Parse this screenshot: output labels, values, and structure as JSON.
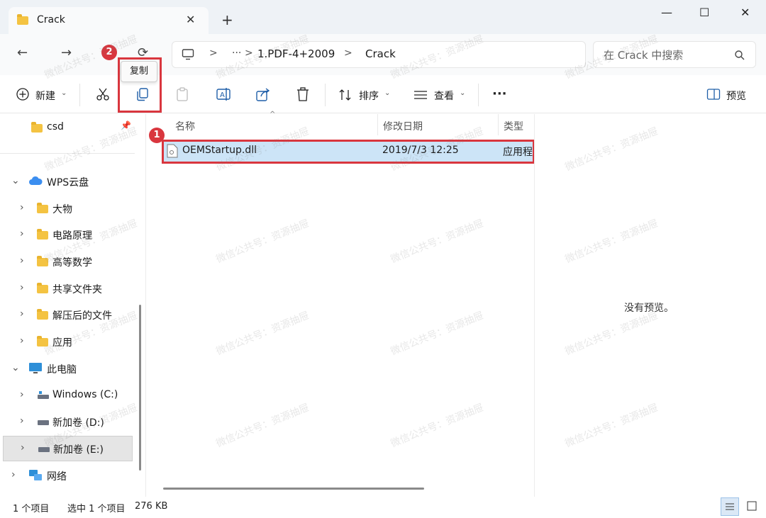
{
  "window": {
    "tab_title": "Crack",
    "tab_close": "✕",
    "new_tab": "+",
    "minimize": "—",
    "maximize": "☐",
    "close": "✕"
  },
  "nav": {
    "back": "←",
    "forward": "→",
    "refresh": "⟳",
    "breadcrumb": {
      "pc_icon": "monitor-icon",
      "more": "···",
      "sep": ">",
      "items": [
        "1.PDF-4+2009",
        "Crack"
      ]
    },
    "search_placeholder": "在 Crack 中搜索"
  },
  "toolbar": {
    "new_label": "新建",
    "sort_label": "排序",
    "view_label": "查看",
    "more": "···",
    "preview_label": "预览",
    "tooltip": "复制"
  },
  "sidebar": {
    "quick": [
      {
        "label": "csd"
      }
    ],
    "wps": {
      "label": "WPS云盘",
      "children": [
        "大物",
        "电路原理",
        "高等数学",
        "共享文件夹",
        "解压后的文件",
        "应用"
      ]
    },
    "pc": {
      "label": "此电脑",
      "drives": [
        "Windows (C:)",
        "新加卷 (D:)",
        "新加卷 (E:)"
      ]
    },
    "network": "网络"
  },
  "columns": {
    "name": "名称",
    "date": "修改日期",
    "type": "类型"
  },
  "files": [
    {
      "name": "OEMStartup.dll",
      "date": "2019/7/3 12:25",
      "type": "应用程"
    }
  ],
  "preview_pane": {
    "empty_text": "没有预览。"
  },
  "status": {
    "count": "1 个项目",
    "selected": "选中 1 个项目",
    "size": "276 KB"
  },
  "annotations": {
    "badge1": "1",
    "badge2": "2"
  },
  "watermark_text": "微信公共号：资源抽屉",
  "colors": {
    "selection": "#cce4f7",
    "annotation_red": "#d9363e",
    "accent": "#1f5fa8"
  }
}
